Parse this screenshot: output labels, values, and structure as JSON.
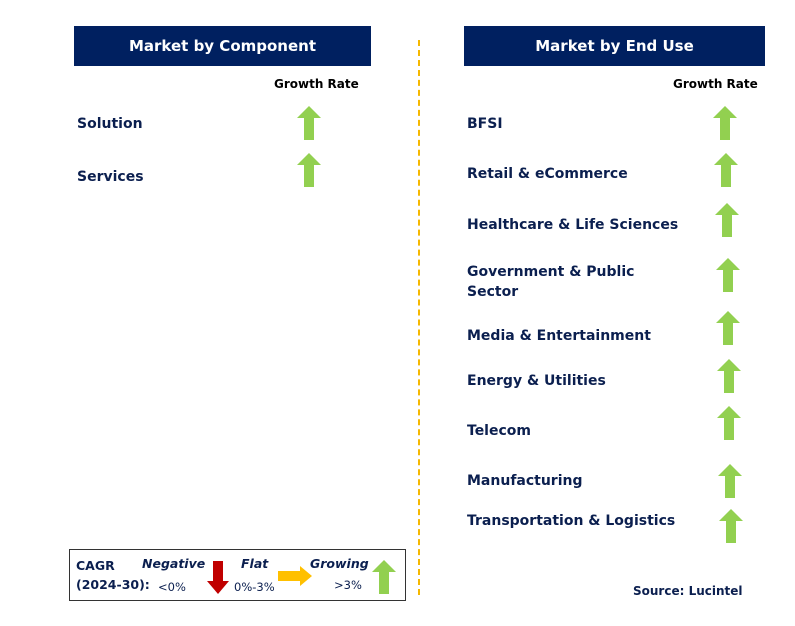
{
  "left": {
    "title": "Market by Component",
    "growth_label": "Growth Rate",
    "items": [
      {
        "label": "Solution",
        "trend": "growing"
      },
      {
        "label": "Services",
        "trend": "growing"
      }
    ]
  },
  "right": {
    "title": "Market by End Use",
    "growth_label": "Growth Rate",
    "items": [
      {
        "label": "BFSI",
        "trend": "growing"
      },
      {
        "label": "Retail & eCommerce",
        "trend": "growing"
      },
      {
        "label": "Healthcare & Life Sciences",
        "trend": "growing"
      },
      {
        "label": "Government & Public Sector",
        "trend": "growing"
      },
      {
        "label": "Media & Entertainment",
        "trend": "growing"
      },
      {
        "label": "Energy & Utilities",
        "trend": "growing"
      },
      {
        "label": "Telecom",
        "trend": "growing"
      },
      {
        "label": "Manufacturing",
        "trend": "growing"
      },
      {
        "label": "Transportation & Logistics",
        "trend": "growing"
      }
    ]
  },
  "legend": {
    "cagr_label": "CAGR",
    "period": "(2024-30):",
    "negative": "Negative",
    "negative_range": "<0%",
    "flat": "Flat",
    "flat_range": "0%-3%",
    "growing": "Growing",
    "growing_range": ">3%"
  },
  "source": "Source: Lucintel",
  "colors": {
    "header": "#002060",
    "growing": "#92D050",
    "flat": "#FFC000",
    "negative": "#C00000",
    "divider": "#F5B800"
  }
}
